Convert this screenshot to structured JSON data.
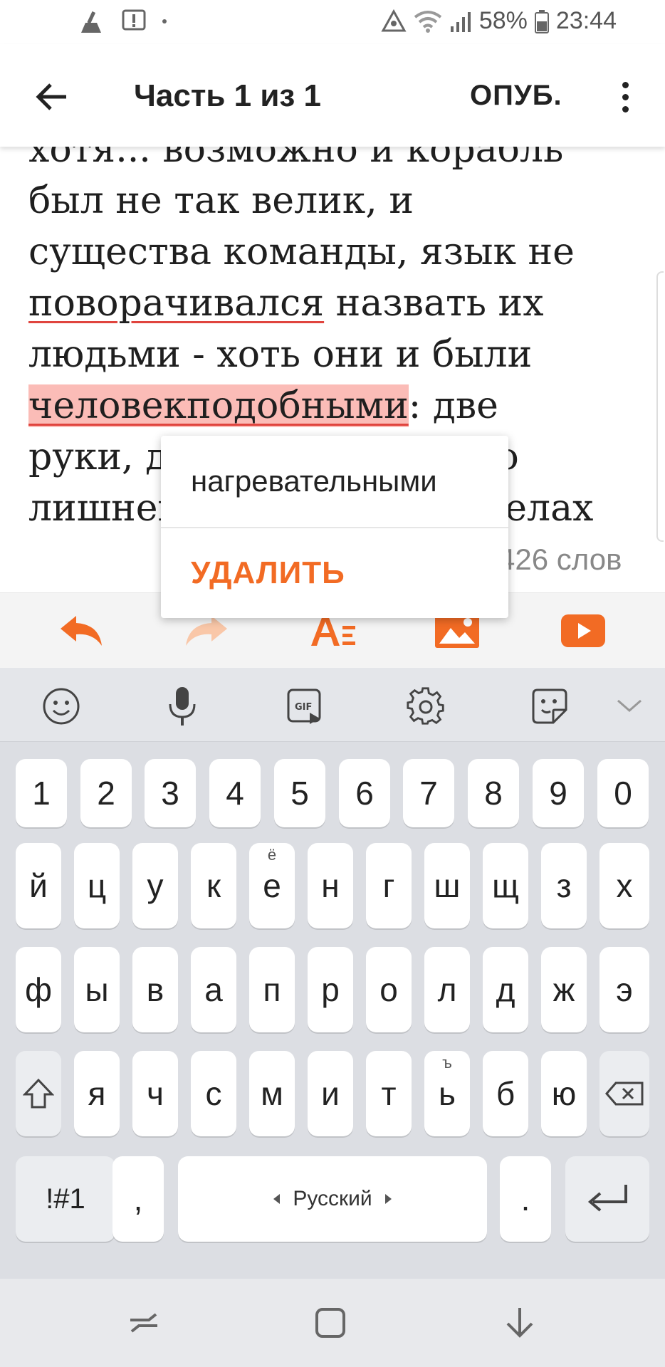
{
  "status_bar": {
    "battery": "58%",
    "time": "23:44"
  },
  "app_bar": {
    "title": "Часть 1 из 1",
    "publish_label": "ОПУБ."
  },
  "story": {
    "lines": [
      {
        "text": "хотя... возможно и корабль"
      },
      {
        "text": "был не так велик, и"
      },
      {
        "text": "существа команды, язык не"
      },
      {
        "pre": "",
        "mark": "поворачивался",
        "post": " назвать их"
      },
      {
        "text": "людьми - хоть они и были"
      },
      {
        "pre": "",
        "sel": "человекподобными",
        "post": ": две"
      },
      {
        "text": "руки, две ноги, никакого"
      },
      {
        "text": "лишнего. Дали лишь в делах"
      }
    ],
    "word_count": "426 слов"
  },
  "suggestion_popup": {
    "suggestion": "нагревательными",
    "delete_label": "УДАЛИТЬ"
  },
  "format_toolbar": {
    "accent_color": "#f26b24",
    "icons": [
      "undo-icon",
      "redo-icon",
      "text-format-icon",
      "image-icon",
      "video-icon"
    ]
  },
  "keyboard": {
    "toolbar_icons": [
      "emoji-icon",
      "microphone-icon",
      "gif-icon",
      "settings-icon",
      "sticker-icon",
      "collapse-icon"
    ],
    "row_numbers": [
      "1",
      "2",
      "3",
      "4",
      "5",
      "6",
      "7",
      "8",
      "9",
      "0"
    ],
    "row1": [
      "й",
      "ц",
      "у",
      "к",
      "е",
      "н",
      "г",
      "ш",
      "щ",
      "з",
      "х"
    ],
    "row1_hint_e": "ё",
    "row2": [
      "ф",
      "ы",
      "в",
      "а",
      "п",
      "р",
      "о",
      "л",
      "д",
      "ж",
      "э"
    ],
    "row3": [
      "я",
      "ч",
      "с",
      "м",
      "и",
      "т",
      "ь",
      "б",
      "ю"
    ],
    "row3_hint_soft": "ъ",
    "symbols_label": "!#1",
    "comma_label": ",",
    "space_label": "Русский",
    "period_label": "."
  },
  "nav_bar": {
    "icons": [
      "recents-icon",
      "home-icon",
      "back-down-icon"
    ]
  }
}
